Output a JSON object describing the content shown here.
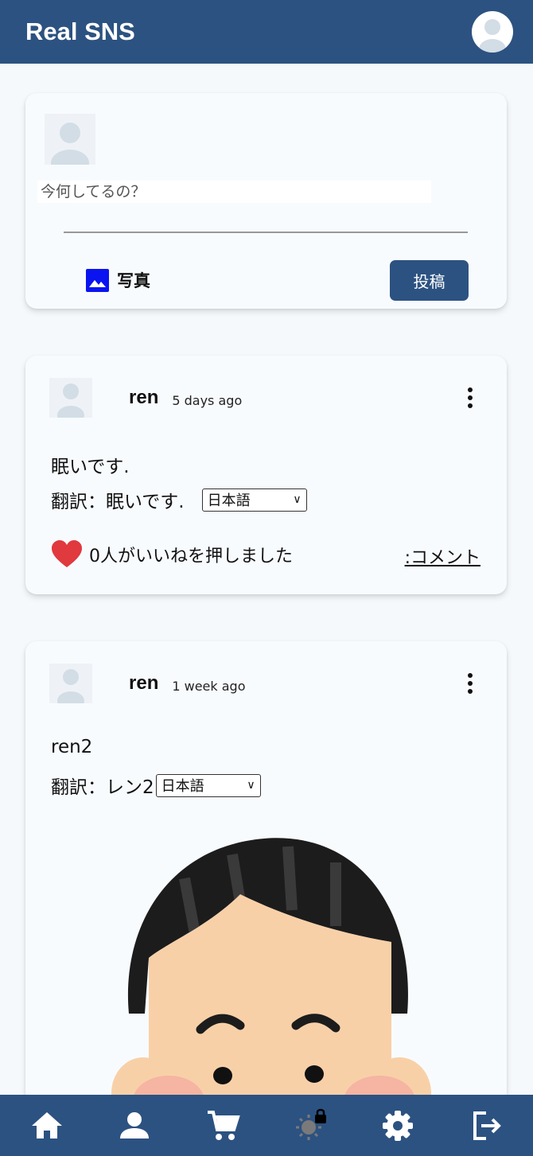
{
  "app": {
    "title": "Real SNS"
  },
  "compose": {
    "placeholder": "今何してるの？",
    "photo_label": "写真",
    "post_label": "投稿"
  },
  "posts": [
    {
      "user": "ren",
      "time": "5 days ago",
      "text": "眠いです.",
      "translation": "翻訳：眠いです.",
      "language": "日本語",
      "likes_text": "0人がいいねを押しました",
      "comment_label": ":コメント"
    },
    {
      "user": "ren",
      "time": "1 week ago",
      "text": "ren2",
      "translation": "翻訳：レン2",
      "language": "日本語"
    }
  ],
  "nav": [
    "home-icon",
    "person-icon",
    "cart-icon",
    "theme-locked-icon",
    "settings-icon",
    "logout-icon"
  ],
  "colors": {
    "primary": "#2c5281",
    "heart": "#e0393e",
    "background": "#f6f9fc"
  }
}
